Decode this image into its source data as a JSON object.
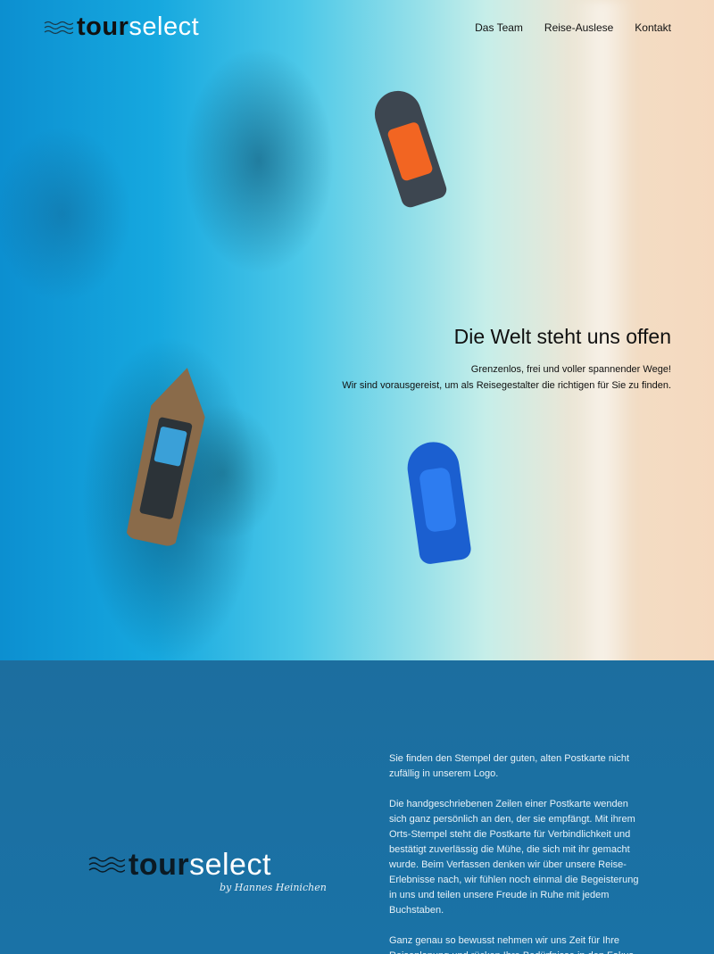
{
  "header": {
    "logo_bold": "tour",
    "logo_light": "select",
    "nav": [
      {
        "label": "Das Team"
      },
      {
        "label": "Reise-Auslese"
      },
      {
        "label": "Kontakt"
      }
    ]
  },
  "hero": {
    "title": "Die Welt steht uns offen",
    "line1": "Grenzenlos, frei und voller spannender Wege!",
    "line2": "Wir sind vorausgereist, um als Reisegestalter die richtigen für Sie zu finden."
  },
  "about": {
    "logo_bold": "tour",
    "logo_light": "select",
    "signature": "by Hannes Heinichen",
    "paragraphs": [
      "Sie finden den Stempel der guten, alten Postkarte nicht zufällig in unserem Logo.",
      "Die handgeschriebenen Zeilen einer Postkarte wenden sich ganz persönlich an den, der sie empfängt. Mit ihrem Orts-Stempel steht die Postkarte für Verbindlichkeit und bestätigt zuverlässig die Mühe, die sich mit ihr gemacht wurde. Beim Verfassen denken wir über unsere Reise-Erlebnisse nach, wir fühlen noch einmal die Begeisterung in uns und teilen unsere Freude in Ruhe mit jedem Buchstaben.",
      "Ganz genau so bewusst nehmen wir uns Zeit für Ihre Reiseplanung und rücken Ihre Bedürfnisse in den Fokus."
    ]
  },
  "colors": {
    "section_blue": "#1a6fa3",
    "boat_orange": "#f26522",
    "boat_blue": "#1b5fd0"
  }
}
